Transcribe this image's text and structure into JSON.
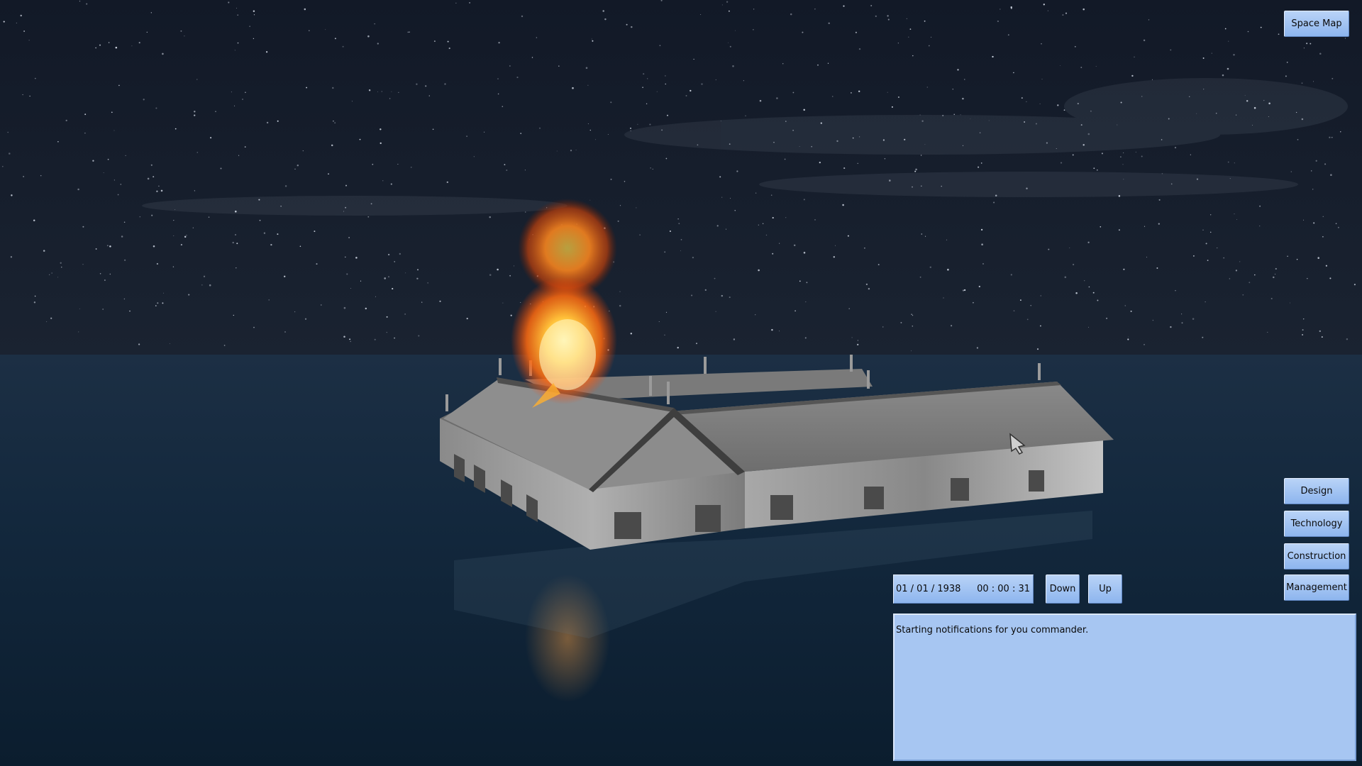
{
  "top_right": {
    "space_map_label": "Space Map"
  },
  "side_menu": {
    "design_label": "Design",
    "technology_label": "Technology",
    "construction_label": "Construction",
    "management_label": "Management"
  },
  "time_controls": {
    "date": "01 / 01 / 1938",
    "time": "00 : 00 : 31",
    "down_label": "Down",
    "up_label": "Up"
  },
  "notifications": {
    "message": "Starting notifications for you commander."
  },
  "colors": {
    "sky": "#0e1522",
    "sea": "#0f2436",
    "button": "#9dc0f2",
    "notification_panel": "#a7c6f2",
    "building": "#8a8a8a",
    "fire": "#ff8a1c"
  }
}
